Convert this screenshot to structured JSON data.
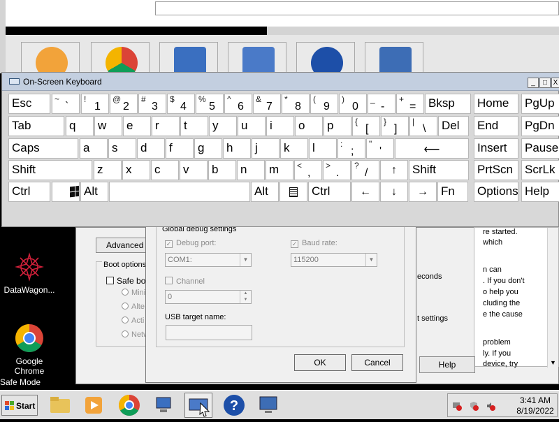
{
  "keyboard": {
    "title": "On-Screen Keyboard",
    "window_buttons": {
      "minimize": "_",
      "restore": "□",
      "close": "X"
    },
    "row1": [
      {
        "label": "Esc"
      },
      {
        "primary": "`",
        "secondary": "~"
      },
      {
        "primary": "1",
        "secondary": "!"
      },
      {
        "primary": "2",
        "secondary": "@"
      },
      {
        "primary": "3",
        "secondary": "#"
      },
      {
        "primary": "4",
        "secondary": "$"
      },
      {
        "primary": "5",
        "secondary": "%"
      },
      {
        "primary": "6",
        "secondary": "^"
      },
      {
        "primary": "7",
        "secondary": "&"
      },
      {
        "primary": "8",
        "secondary": "*"
      },
      {
        "primary": "9",
        "secondary": "("
      },
      {
        "primary": "0",
        "secondary": ")"
      },
      {
        "primary": "-",
        "secondary": "_"
      },
      {
        "primary": "=",
        "secondary": "+"
      },
      {
        "label": "Bksp"
      },
      {
        "label": "Home"
      },
      {
        "label": "PgUp"
      }
    ],
    "row2": [
      {
        "label": "Tab"
      },
      {
        "label": "q"
      },
      {
        "label": "w"
      },
      {
        "label": "e"
      },
      {
        "label": "r"
      },
      {
        "label": "t"
      },
      {
        "label": "y"
      },
      {
        "label": "u"
      },
      {
        "label": "i"
      },
      {
        "label": "o"
      },
      {
        "label": "p"
      },
      {
        "primary": "[",
        "secondary": "{"
      },
      {
        "primary": "]",
        "secondary": "}"
      },
      {
        "primary": "\\",
        "secondary": "|"
      },
      {
        "label": "Del"
      },
      {
        "label": "End"
      },
      {
        "label": "PgDn"
      }
    ],
    "row3": [
      {
        "label": "Caps"
      },
      {
        "label": "a"
      },
      {
        "label": "s"
      },
      {
        "label": "d"
      },
      {
        "label": "f"
      },
      {
        "label": "g"
      },
      {
        "label": "h"
      },
      {
        "label": "j"
      },
      {
        "label": "k"
      },
      {
        "label": "l"
      },
      {
        "primary": ";",
        "secondary": ":"
      },
      {
        "primary": "'",
        "secondary": "\""
      },
      {
        "label": "⟵"
      },
      {
        "label": "Insert"
      },
      {
        "label": "Pause"
      }
    ],
    "row4": [
      {
        "label": "Shift"
      },
      {
        "label": "z"
      },
      {
        "label": "x"
      },
      {
        "label": "c"
      },
      {
        "label": "v"
      },
      {
        "label": "b"
      },
      {
        "label": "n"
      },
      {
        "label": "m"
      },
      {
        "primary": ",",
        "secondary": "<"
      },
      {
        "primary": ".",
        "secondary": ">"
      },
      {
        "primary": "/",
        "secondary": "?"
      },
      {
        "label": "↑"
      },
      {
        "label": "Shift"
      },
      {
        "label": "PrtScn"
      },
      {
        "label": "ScrLk"
      }
    ],
    "row5": [
      {
        "label": "Ctrl"
      },
      {
        "label": ""
      },
      {
        "label": "Alt"
      },
      {
        "label": ""
      },
      {
        "label": "Alt"
      },
      {
        "label": ""
      },
      {
        "label": "Ctrl"
      },
      {
        "label": "←"
      },
      {
        "label": "↓"
      },
      {
        "label": "→"
      },
      {
        "label": "Fn"
      },
      {
        "label": "Options"
      },
      {
        "label": "Help"
      }
    ]
  },
  "desktop": {
    "icons": [
      {
        "label_lines": [
          "DataWagon..."
        ]
      },
      {
        "label_lines": [
          "Google",
          "Chrome"
        ]
      }
    ],
    "safe_mode": "Safe Mode"
  },
  "startup_dialog": {
    "advanced_button": "Advanced c",
    "boot_options_label": "Boot options",
    "safe_boot_label": "Safe bo",
    "options": [
      "Mini",
      "Alte",
      "Acti",
      "Netw"
    ],
    "seconds_text": "econds",
    "settings_text": "t settings",
    "help_button": "Help",
    "help_lines": [
      "re started.",
      "which",
      "",
      "n can",
      ". If you don't",
      "o help you",
      "cluding the",
      "e the cause",
      "",
      "problem",
      "ly. If you",
      "device, try"
    ]
  },
  "debug_dialog": {
    "group_label": "Global debug settings",
    "debug_port_label": "Debug port:",
    "debug_port_value": "COM1:",
    "baud_rate_label": "Baud rate:",
    "baud_rate_value": "115200",
    "channel_label": "Channel",
    "channel_value": "0",
    "usb_label": "USB target name:",
    "usb_value": "",
    "ok_button": "OK",
    "cancel_button": "Cancel"
  },
  "taskbar": {
    "start_label": "Start",
    "time": "3:41 AM",
    "date": "8/19/2022"
  },
  "colors": {
    "keyboard_title_bg": "#c3cfe0",
    "key_bg": "#ffffff",
    "taskbar_bg": "#dfdfdf"
  }
}
